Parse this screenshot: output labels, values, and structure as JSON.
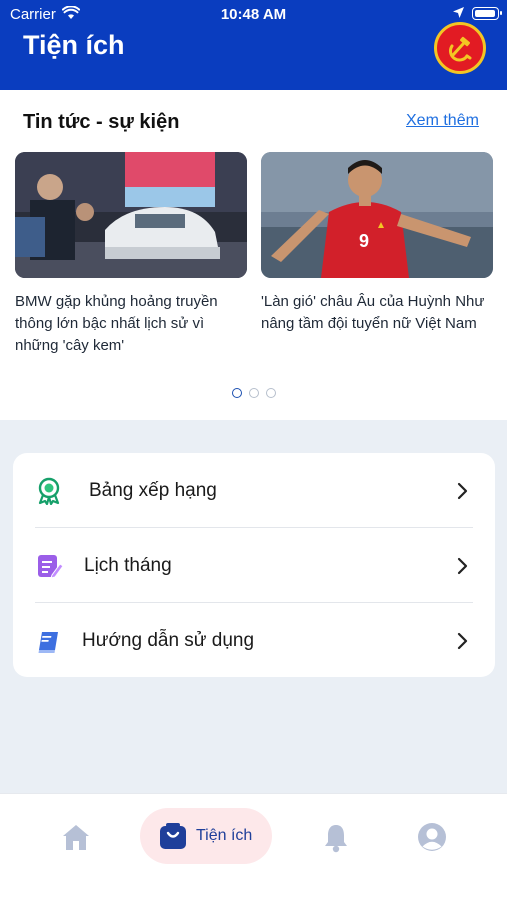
{
  "status_bar": {
    "carrier": "Carrier",
    "time": "10:48 AM"
  },
  "header": {
    "title": "Tiện ích",
    "emblem_icon": "hammer-sickle-icon"
  },
  "news": {
    "title": "Tin tức - sự kiện",
    "see_more": "Xem thêm",
    "cards": [
      {
        "caption": "BMW gặp khủng hoảng truyền thông lớn bậc nhất lịch sử vì những 'cây kem'"
      },
      {
        "caption": "'Làn gió' châu Âu của Huỳnh Như nâng tầm đội tuyển nữ Việt Nam"
      }
    ],
    "pager": {
      "total": 3,
      "active": 1
    }
  },
  "menu": {
    "items": [
      {
        "label": "Bảng xếp hạng",
        "icon": "award-badge-icon"
      },
      {
        "label": "Lịch tháng",
        "icon": "calendar-edit-icon"
      },
      {
        "label": "Hướng dẫn sử dụng",
        "icon": "book-icon"
      }
    ]
  },
  "bottom_nav": {
    "items": [
      {
        "name": "home",
        "icon": "home-icon"
      },
      {
        "name": "utilities",
        "label": "Tiện ích",
        "icon": "bag-icon",
        "active": true
      },
      {
        "name": "notifications",
        "icon": "bell-icon"
      },
      {
        "name": "profile",
        "icon": "user-icon"
      }
    ]
  },
  "colors": {
    "header_bg": "#0a3dbf",
    "link": "#1f6fe0",
    "active_tab_bg": "#fde8ea"
  }
}
